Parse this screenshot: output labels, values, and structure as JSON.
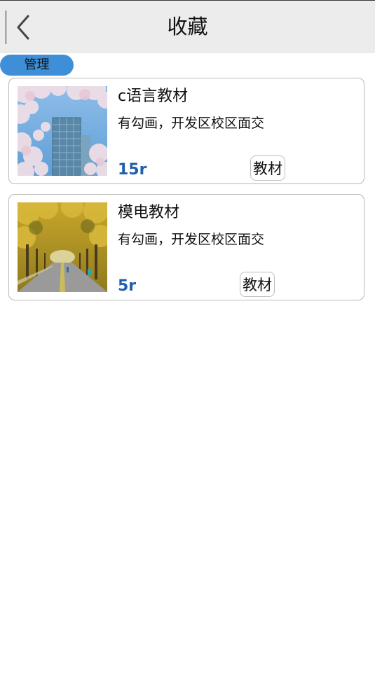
{
  "header": {
    "title": "收藏",
    "back_icon": "chevron-left-icon"
  },
  "toolbar": {
    "manage_label": "管理"
  },
  "colors": {
    "accent": "#3f8fd8",
    "price": "#1f5fae",
    "header_bg": "#ececec"
  },
  "items": [
    {
      "name": "c语言教材",
      "description": "有勾画，开发区校区面交",
      "price": "15r",
      "tag": "教材"
    },
    {
      "name": "模电教材",
      "description": "有勾画，开发区校区面交",
      "price": "5r",
      "tag": "教材"
    }
  ]
}
